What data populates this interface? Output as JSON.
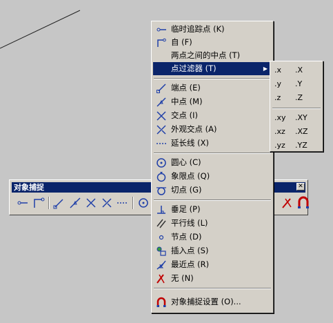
{
  "toolbar": {
    "title": "对象捕捉",
    "close_glyph": "✕"
  },
  "menu": {
    "items": [
      {
        "label": "临时追踪点 (K)",
        "icon": "temp-track-point-icon"
      },
      {
        "label": "自 (F)",
        "icon": "from-icon"
      },
      {
        "label": "两点之间的中点 (T)",
        "icon": ""
      },
      {
        "label": "点过滤器 (T)",
        "icon": "",
        "submenu_arrow": "▶"
      },
      {
        "label": "端点 (E)",
        "icon": "endpoint-icon"
      },
      {
        "label": "中点 (M)",
        "icon": "midpoint-icon"
      },
      {
        "label": "交点 (I)",
        "icon": "intersection-icon"
      },
      {
        "label": "外观交点 (A)",
        "icon": "apparent-intersection-icon"
      },
      {
        "label": "延长线 (X)",
        "icon": "extension-icon"
      },
      {
        "label": "圆心 (C)",
        "icon": "center-icon"
      },
      {
        "label": "象限点 (Q)",
        "icon": "quadrant-icon"
      },
      {
        "label": "切点 (G)",
        "icon": "tangent-icon"
      },
      {
        "label": "垂足 (P)",
        "icon": "perpendicular-icon"
      },
      {
        "label": "平行线 (L)",
        "icon": "parallel-icon"
      },
      {
        "label": "节点 (D)",
        "icon": "node-icon"
      },
      {
        "label": "插入点 (S)",
        "icon": "insertion-icon"
      },
      {
        "label": "最近点 (R)",
        "icon": "nearest-icon"
      },
      {
        "label": "无 (N)",
        "icon": "none-icon"
      },
      {
        "label": "对象捕捉设置 (O)...",
        "icon": "osnap-settings-icon"
      }
    ]
  },
  "submenu": {
    "items": [
      {
        "key": ".x",
        "label": ".X"
      },
      {
        "key": ".y",
        "label": ".Y"
      },
      {
        "key": ".z",
        "label": ".Z"
      },
      {
        "key": ".xy",
        "label": ".XY"
      },
      {
        "key": ".xz",
        "label": ".XZ"
      },
      {
        "key": ".yz",
        "label": ".YZ"
      }
    ]
  },
  "colors": {
    "highlight": "#0a246a",
    "face": "#d4d0c8",
    "background": "#c6c6c6",
    "icon_blue": "#1f3fa8",
    "icon_red": "#c00000"
  }
}
